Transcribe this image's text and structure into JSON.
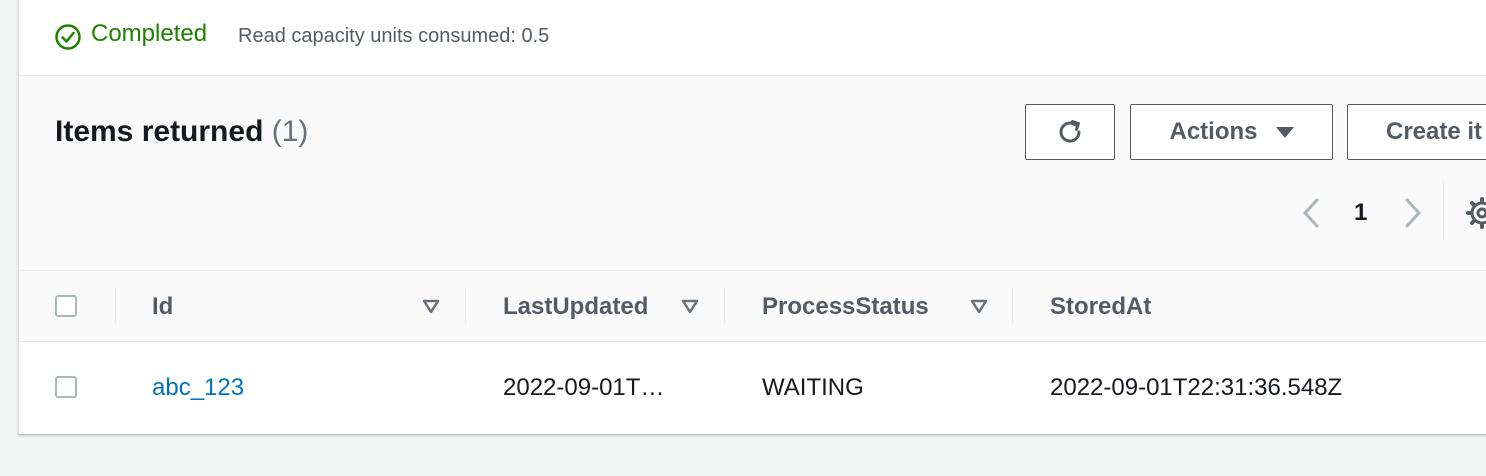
{
  "status": {
    "icon": "check-circle-icon",
    "label": "Completed",
    "detail": "Read capacity units consumed: 0.5",
    "color": "#1d8102"
  },
  "items_panel": {
    "title": "Items returned",
    "count": "(1)",
    "buttons": {
      "refresh_icon": "refresh-icon",
      "actions_label": "Actions",
      "create_label": "Create it"
    },
    "pagination": {
      "current_page": "1"
    }
  },
  "table": {
    "columns": [
      "Id",
      "LastUpdated",
      "ProcessStatus",
      "StoredAt"
    ],
    "rows": [
      {
        "Id": "abc_123",
        "LastUpdated": "2022-09-01T…",
        "ProcessStatus": "WAITING",
        "StoredAt": "2022-09-01T22:31:36.548Z"
      }
    ]
  },
  "colors": {
    "link": "#0073bb",
    "success": "#1d8102",
    "button_border": "#545b64"
  }
}
